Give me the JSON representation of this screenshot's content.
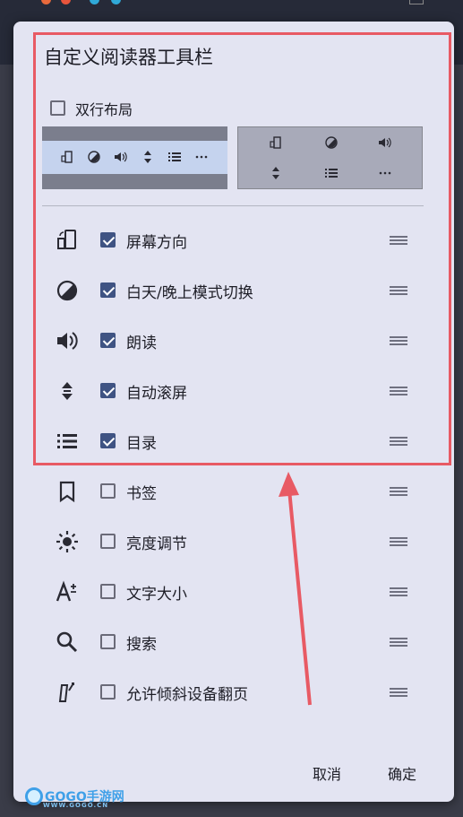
{
  "dialog": {
    "title": "自定义阅读器工具栏",
    "double_row": {
      "label": "双行布局",
      "checked": false
    },
    "items": [
      {
        "icon": "screen-rotation-icon",
        "label": "屏幕方向",
        "checked": true
      },
      {
        "icon": "day-night-toggle-icon",
        "label": "白天/晚上模式切换",
        "checked": true
      },
      {
        "icon": "speaker-icon",
        "label": "朗读",
        "checked": true
      },
      {
        "icon": "auto-scroll-icon",
        "label": "自动滚屏",
        "checked": true
      },
      {
        "icon": "list-icon",
        "label": "目录",
        "checked": true
      },
      {
        "icon": "bookmark-icon",
        "label": "书签",
        "checked": false
      },
      {
        "icon": "brightness-icon",
        "label": "亮度调节",
        "checked": false
      },
      {
        "icon": "font-size-icon",
        "label": "文字大小",
        "checked": false
      },
      {
        "icon": "search-icon",
        "label": "搜索",
        "checked": false
      },
      {
        "icon": "tilt-device-icon",
        "label": "允许倾斜设备翻页",
        "checked": false
      }
    ],
    "cancel_label": "取消",
    "confirm_label": "确定"
  },
  "watermark": {
    "text": "GOGO手游网",
    "sub": "WWW.GOGO.CN"
  },
  "colors": {
    "accent": "#3f5383",
    "highlight": "#e85a64",
    "dialog_bg": "#e3e4f2"
  }
}
